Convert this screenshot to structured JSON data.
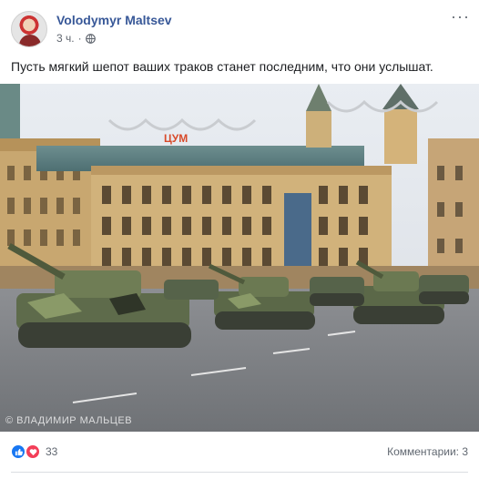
{
  "post": {
    "author": "Volodymyr Maltsev",
    "time": "3 ч.",
    "separator": "·",
    "text": "Пусть мягкий шепот ваших траков станет последним, что они услышат.",
    "more_label": "···"
  },
  "photo": {
    "watermark": "© ВЛАДИМИР МАЛЬЦЕВ",
    "sign": "ЦУМ"
  },
  "footer": {
    "reaction_count": "33",
    "comments": "Комментарии: 3"
  },
  "colors": {
    "link_blue": "#385898",
    "like_blue": "#1877f2",
    "love_red": "#f33e58"
  }
}
